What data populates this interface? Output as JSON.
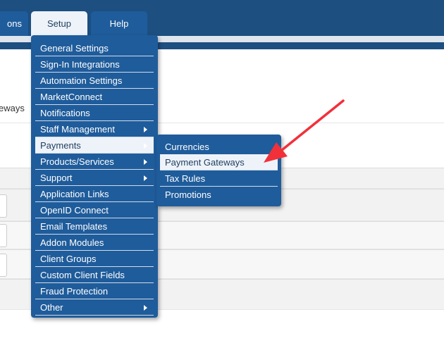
{
  "nav": {
    "tabs": [
      {
        "label": "ons"
      },
      {
        "label": "Setup"
      },
      {
        "label": "Help"
      }
    ]
  },
  "page": {
    "partial_text": "eways"
  },
  "setup_menu": {
    "items": [
      {
        "label": "General Settings"
      },
      {
        "label": "Sign-In Integrations"
      },
      {
        "label": "Automation Settings"
      },
      {
        "label": "MarketConnect"
      },
      {
        "label": "Notifications"
      },
      {
        "label": "Staff Management"
      },
      {
        "label": "Payments"
      },
      {
        "label": "Products/Services"
      },
      {
        "label": "Support"
      },
      {
        "label": "Application Links"
      },
      {
        "label": "OpenID Connect"
      },
      {
        "label": "Email Templates"
      },
      {
        "label": "Addon Modules"
      },
      {
        "label": "Client Groups"
      },
      {
        "label": "Custom Client Fields"
      },
      {
        "label": "Fraud Protection"
      },
      {
        "label": "Other"
      }
    ]
  },
  "payments_submenu": {
    "items": [
      {
        "label": "Currencies"
      },
      {
        "label": "Payment Gateways"
      },
      {
        "label": "Tax Rules"
      },
      {
        "label": "Promotions"
      }
    ]
  },
  "colors": {
    "nav_bar": "#1d4f81",
    "menu_bg": "#1f5c9b",
    "highlight_bg": "#eef3f9",
    "annotation_arrow": "#f2303a"
  }
}
